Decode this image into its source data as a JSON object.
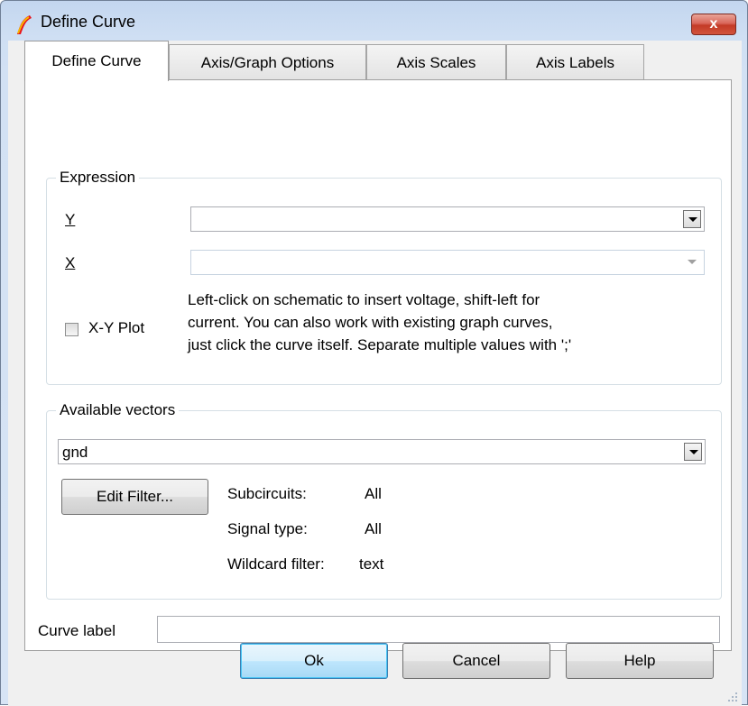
{
  "window": {
    "title": "Define Curve",
    "close_label": "x"
  },
  "tabs": [
    {
      "label": "Define Curve"
    },
    {
      "label": "Axis/Graph Options"
    },
    {
      "label": "Axis Scales"
    },
    {
      "label": "Axis Labels"
    }
  ],
  "expression": {
    "group_label": "Expression",
    "y_label": "Y",
    "y_value": "",
    "x_label": "X",
    "x_value": "",
    "xy_plot_label": "X-Y Plot",
    "xy_plot_checked": false,
    "hint_line1": "Left-click on schematic to insert voltage, shift-left for",
    "hint_line2": "current. You can also work with existing graph curves,",
    "hint_line3": "just click the curve itself. Separate multiple values with ';'"
  },
  "vectors": {
    "group_label": "Available vectors",
    "selected": "gnd",
    "edit_filter_label": "Edit Filter...",
    "subcircuits_label": "Subcircuits:",
    "subcircuits_value": "All",
    "signal_type_label": "Signal type:",
    "signal_type_value": "All",
    "wildcard_label": "Wildcard filter:",
    "wildcard_value": "text"
  },
  "curve_label": {
    "label": "Curve label",
    "value": ""
  },
  "buttons": {
    "ok": "Ok",
    "cancel": "Cancel",
    "help": "Help"
  },
  "colors": {
    "title_gradient": "#cfdff3",
    "close_button": "#c33a26",
    "default_button": "#bee6fd"
  },
  "icons": [
    "app-logo-icon",
    "close-icon",
    "dropdown-arrow-icon",
    "resize-grip-icon"
  ]
}
